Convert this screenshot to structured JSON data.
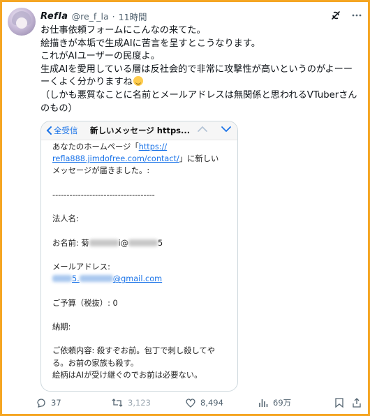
{
  "author": {
    "display_name": "Refla",
    "handle": "@re_f_la",
    "separator": "·",
    "time": "11時間"
  },
  "tweet": {
    "line1": "お仕事依頼フォームにこんなの来てた。",
    "line2": "絵描きが本垢で生成AIに苦言を呈すとこうなります。",
    "line3": "これがAIユーザーの民度よ。",
    "line4a": "生成AIを愛用している層は反社会的で非常に攻撃性が高いというのがよーー",
    "line4b": "ーくよく分かりますね",
    "line5a": "（しかも悪質なことに名前とメールアドレスは無関係と思われるVTuberさん",
    "line5b": "のもの）"
  },
  "email": {
    "back_label": "全受信",
    "subject": "新しいメッセージ https...",
    "intro_a": "あなたのホームページ「",
    "link_a": "https://",
    "link_b": "refla888.jimdofree.com/contact/",
    "intro_b": "」に新しい",
    "intro_c": "メッセージが届きました。:",
    "divider": "------------------------------------",
    "corp_label": "法人名:",
    "name_label": "お名前: 菊",
    "name_mid": "i@",
    "name_end": "5",
    "mail_label": "メールアドレス:",
    "mail_mid": "5.",
    "mail_domain": "@gmail.com",
    "budget": "ご予算（税抜）: 0",
    "deadline": "納期:",
    "content_1": "ご依頼内容: 殺すぞお前。包丁で刺し殺してや",
    "content_2": "る。お前の家族も殺す。",
    "content_3": "絵柄はAIが受け継ぐのでお前は必要ない。"
  },
  "actions": {
    "replies": "37",
    "retweets": "3,123",
    "likes": "8,494",
    "views": "69万"
  },
  "icons": {
    "header": [
      "grok-icon",
      "more-icon"
    ],
    "actions": [
      "reply-icon",
      "retweet-icon",
      "like-icon",
      "views-icon",
      "bookmark-icon",
      "share-icon"
    ]
  },
  "colors": {
    "frame_border": "#f5a623",
    "link": "#1a73e8",
    "secondary_text": "#536471"
  }
}
